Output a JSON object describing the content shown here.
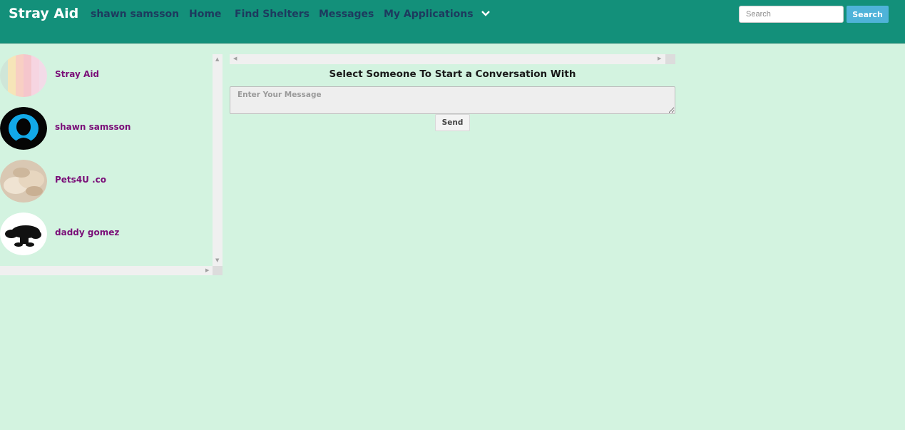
{
  "navbar": {
    "brand": "Stray Aid",
    "links": [
      "shawn samsson",
      "Home",
      "Find Shelters",
      "Messages",
      "My Applications"
    ],
    "dropdown_icon": "chevron-down-icon",
    "search": {
      "placeholder": "Search",
      "button_label": "Search"
    }
  },
  "contacts": [
    {
      "name": "Stray Aid",
      "avatar": "pastel-stripes-avatar"
    },
    {
      "name": "shawn samsson",
      "avatar": "person-silhouette-avatar"
    },
    {
      "name": "Pets4U .co",
      "avatar": "sleeping-pet-photo-avatar"
    },
    {
      "name": "daddy gomez",
      "avatar": "dog-silhouette-avatar"
    }
  ],
  "conversation": {
    "title": "Select Someone To Start a Conversation With",
    "message_placeholder": "Enter Your Message",
    "send_label": "Send"
  },
  "colors": {
    "navbar": "#13907a",
    "background": "#d3f3e0",
    "contact_name": "#7a0e78",
    "nav_link": "#1d3a5e",
    "search_button": "#4fb3d9"
  }
}
